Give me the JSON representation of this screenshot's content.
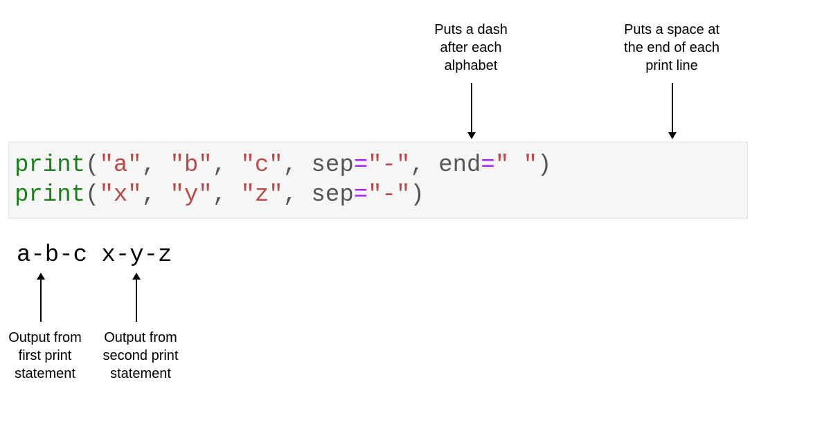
{
  "annotations": {
    "top_sep": "Puts a dash\nafter each\nalphabet",
    "top_end": "Puts a space at\nthe end of each\nprint line",
    "bottom_first": "Output from\nfirst print\nstatement",
    "bottom_second": "Output from\nsecond print\nstatement"
  },
  "code": {
    "line1": {
      "fn": "print",
      "open": "(",
      "arg_a": "\"a\"",
      "comma": ",",
      "arg_b": "\"b\"",
      "arg_c": "\"c\"",
      "sep_key": "sep",
      "eq": "=",
      "sep_val": "\"-\"",
      "end_key": "end",
      "end_val": "\" \"",
      "close": ")"
    },
    "line2": {
      "fn": "print",
      "open": "(",
      "arg_x": "\"x\"",
      "arg_y": "\"y\"",
      "arg_z": "\"z\"",
      "sep_key": "sep",
      "eq": "=",
      "sep_val": "\"-\"",
      "close": ")"
    }
  },
  "output": "a-b-c x-y-z"
}
